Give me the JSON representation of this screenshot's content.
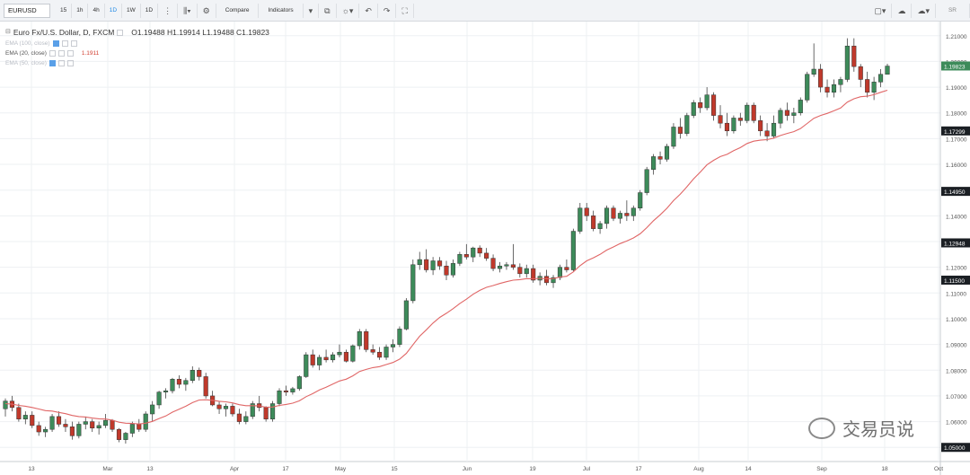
{
  "toolbar": {
    "symbol": "EURUSD",
    "intervals": [
      "15",
      "1h",
      "4h",
      "1D",
      "1W",
      "1D"
    ],
    "compare_label": "Compare",
    "indicators_label": "Indicators",
    "right_label": "SR"
  },
  "legend": {
    "title": "Euro Fx/U.S. Dollar, D, FXCM",
    "ohlc": "O1.19488  H1.19914  L1.19488  C1.19823",
    "ema_label": "EMA (20, close)",
    "ema_value": "1.1911",
    "faint_row1": "EMA (100, close)",
    "faint_row3": "EMA (50, close)"
  },
  "watermark": "交易员说",
  "colors": {
    "up": "#3d8b5a",
    "down": "#c0392b",
    "ema": "#e06666",
    "axis_text": "#555555",
    "grid": "#eef0f3"
  },
  "chart_data": {
    "type": "candlestick",
    "title": "Euro Fx/U.S. Dollar, D, FXCM",
    "ylim": [
      1.0445,
      1.2155
    ],
    "y_ticks": [
      "1.21000",
      "1.20000",
      "1.19000",
      "1.18000",
      "1.17000",
      "1.16000",
      "1.15000",
      "1.14000",
      "1.13000",
      "1.12000",
      "1.11000",
      "1.10000",
      "1.09000",
      "1.08000",
      "1.07000",
      "1.06000",
      "1.05000"
    ],
    "x_ticks": [
      "13",
      "Mar",
      "13",
      "Apr",
      "17",
      "May",
      "15",
      "Jun",
      "19",
      "Jul",
      "17",
      "Aug",
      "14",
      "Sep",
      "18",
      "Oct"
    ],
    "price_labels": [
      {
        "value": "1.19823",
        "style": "green"
      },
      {
        "value": "1.17299",
        "style": "dark"
      },
      {
        "value": "1.14950",
        "style": "dark"
      },
      {
        "value": "1.12948",
        "style": "dark"
      },
      {
        "value": "1.11500",
        "style": "dark"
      },
      {
        "value": "1.05000",
        "style": "dark"
      }
    ],
    "series": [
      {
        "name": "EURUSD",
        "kind": "candles",
        "ohlc": [
          [
            1.065,
            1.069,
            1.062,
            1.068
          ],
          [
            1.068,
            1.07,
            1.064,
            1.0655
          ],
          [
            1.0655,
            1.067,
            1.06,
            1.061
          ],
          [
            1.061,
            1.064,
            1.059,
            1.0625
          ],
          [
            1.0625,
            1.064,
            1.0575,
            1.0585
          ],
          [
            1.0585,
            1.06,
            1.0545,
            1.056
          ],
          [
            1.056,
            1.058,
            1.054,
            1.057
          ],
          [
            1.057,
            1.063,
            1.056,
            1.062
          ],
          [
            1.062,
            1.064,
            1.058,
            1.059
          ],
          [
            1.059,
            1.061,
            1.056,
            1.058
          ],
          [
            1.058,
            1.06,
            1.053,
            1.0545
          ],
          [
            1.0545,
            1.06,
            1.0535,
            1.059
          ],
          [
            1.059,
            1.062,
            1.057,
            1.06
          ],
          [
            1.06,
            1.061,
            1.056,
            1.0575
          ],
          [
            1.0575,
            1.06,
            1.055,
            1.0585
          ],
          [
            1.0585,
            1.063,
            1.0575,
            1.0605
          ],
          [
            1.0605,
            1.061,
            1.056,
            1.057
          ],
          [
            1.057,
            1.0575,
            1.052,
            1.053
          ],
          [
            1.053,
            1.056,
            1.0515,
            1.0555
          ],
          [
            1.0555,
            1.06,
            1.054,
            1.059
          ],
          [
            1.059,
            1.061,
            1.056,
            1.057
          ],
          [
            1.057,
            1.064,
            1.056,
            1.063
          ],
          [
            1.063,
            1.068,
            1.06,
            1.0665
          ],
          [
            1.0665,
            1.072,
            1.065,
            1.0715
          ],
          [
            1.0715,
            1.073,
            1.069,
            1.072
          ],
          [
            1.072,
            1.077,
            1.071,
            1.0765
          ],
          [
            1.0765,
            1.078,
            1.073,
            1.0745
          ],
          [
            1.0745,
            1.077,
            1.072,
            1.076
          ],
          [
            1.076,
            1.0815,
            1.075,
            1.08
          ],
          [
            1.08,
            1.081,
            1.076,
            1.0775
          ],
          [
            1.0775,
            1.079,
            1.069,
            1.07
          ],
          [
            1.07,
            1.072,
            1.066,
            1.0665
          ],
          [
            1.0665,
            1.068,
            1.063,
            1.065
          ],
          [
            1.065,
            1.067,
            1.062,
            1.066
          ],
          [
            1.066,
            1.067,
            1.062,
            1.063
          ],
          [
            1.063,
            1.065,
            1.059,
            1.06
          ],
          [
            1.06,
            1.064,
            1.059,
            1.062
          ],
          [
            1.062,
            1.068,
            1.061,
            1.067
          ],
          [
            1.067,
            1.07,
            1.064,
            1.0655
          ],
          [
            1.0655,
            1.066,
            1.06,
            1.061
          ],
          [
            1.061,
            1.068,
            1.06,
            1.067
          ],
          [
            1.067,
            1.073,
            1.066,
            1.072
          ],
          [
            1.072,
            1.074,
            1.07,
            1.0715
          ],
          [
            1.0715,
            1.0735,
            1.0705,
            1.0728
          ],
          [
            1.0728,
            1.078,
            1.072,
            1.0775
          ],
          [
            1.0775,
            1.087,
            1.077,
            1.086
          ],
          [
            1.086,
            1.088,
            1.081,
            1.082
          ],
          [
            1.082,
            1.086,
            1.08,
            1.085
          ],
          [
            1.085,
            1.088,
            1.083,
            1.084
          ],
          [
            1.084,
            1.087,
            1.083,
            1.086
          ],
          [
            1.086,
            1.09,
            1.085,
            1.087
          ],
          [
            1.087,
            1.088,
            1.083,
            1.0835
          ],
          [
            1.0835,
            1.09,
            1.083,
            1.0895
          ],
          [
            1.0895,
            1.096,
            1.088,
            1.095
          ],
          [
            1.095,
            1.096,
            1.087,
            1.088
          ],
          [
            1.088,
            1.09,
            1.086,
            1.087
          ],
          [
            1.087,
            1.089,
            1.084,
            1.085
          ],
          [
            1.085,
            1.09,
            1.084,
            1.089
          ],
          [
            1.089,
            1.092,
            1.087,
            1.09
          ],
          [
            1.09,
            1.097,
            1.089,
            1.096
          ],
          [
            1.096,
            1.108,
            1.0955,
            1.107
          ],
          [
            1.107,
            1.123,
            1.106,
            1.121
          ],
          [
            1.121,
            1.126,
            1.119,
            1.123
          ],
          [
            1.123,
            1.127,
            1.118,
            1.119
          ],
          [
            1.119,
            1.124,
            1.117,
            1.1225
          ],
          [
            1.1225,
            1.124,
            1.119,
            1.1205
          ],
          [
            1.1205,
            1.1225,
            1.115,
            1.117
          ],
          [
            1.117,
            1.123,
            1.116,
            1.1215
          ],
          [
            1.1215,
            1.126,
            1.1205,
            1.125
          ],
          [
            1.125,
            1.129,
            1.123,
            1.124
          ],
          [
            1.124,
            1.128,
            1.122,
            1.1275
          ],
          [
            1.1275,
            1.1285,
            1.124,
            1.1255
          ],
          [
            1.1255,
            1.1275,
            1.1225,
            1.1235
          ],
          [
            1.1235,
            1.125,
            1.1185,
            1.1195
          ],
          [
            1.1195,
            1.122,
            1.118,
            1.1205
          ],
          [
            1.1205,
            1.122,
            1.119,
            1.121
          ],
          [
            1.121,
            1.129,
            1.119,
            1.12
          ],
          [
            1.12,
            1.1215,
            1.116,
            1.1175
          ],
          [
            1.1175,
            1.121,
            1.116,
            1.1195
          ],
          [
            1.1195,
            1.121,
            1.114,
            1.115
          ],
          [
            1.115,
            1.118,
            1.113,
            1.1165
          ],
          [
            1.1165,
            1.119,
            1.113,
            1.114
          ],
          [
            1.114,
            1.117,
            1.112,
            1.116
          ],
          [
            1.116,
            1.121,
            1.115,
            1.12
          ],
          [
            1.12,
            1.123,
            1.118,
            1.119
          ],
          [
            1.119,
            1.135,
            1.1185,
            1.134
          ],
          [
            1.134,
            1.145,
            1.133,
            1.143
          ],
          [
            1.143,
            1.145,
            1.138,
            1.14
          ],
          [
            1.14,
            1.142,
            1.134,
            1.135
          ],
          [
            1.135,
            1.138,
            1.133,
            1.137
          ],
          [
            1.137,
            1.144,
            1.135,
            1.143
          ],
          [
            1.143,
            1.144,
            1.138,
            1.139
          ],
          [
            1.139,
            1.142,
            1.137,
            1.141
          ],
          [
            1.141,
            1.146,
            1.138,
            1.14
          ],
          [
            1.14,
            1.144,
            1.138,
            1.143
          ],
          [
            1.143,
            1.15,
            1.142,
            1.149
          ],
          [
            1.149,
            1.159,
            1.148,
            1.158
          ],
          [
            1.158,
            1.164,
            1.156,
            1.163
          ],
          [
            1.163,
            1.165,
            1.16,
            1.162
          ],
          [
            1.162,
            1.168,
            1.161,
            1.167
          ],
          [
            1.167,
            1.176,
            1.166,
            1.1745
          ],
          [
            1.1745,
            1.178,
            1.17,
            1.172
          ],
          [
            1.172,
            1.18,
            1.171,
            1.179
          ],
          [
            1.179,
            1.185,
            1.178,
            1.184
          ],
          [
            1.184,
            1.186,
            1.18,
            1.182
          ],
          [
            1.182,
            1.19,
            1.181,
            1.187
          ],
          [
            1.187,
            1.188,
            1.177,
            1.179
          ],
          [
            1.179,
            1.183,
            1.174,
            1.176
          ],
          [
            1.176,
            1.18,
            1.171,
            1.173
          ],
          [
            1.173,
            1.179,
            1.172,
            1.178
          ],
          [
            1.178,
            1.18,
            1.175,
            1.177
          ],
          [
            1.177,
            1.184,
            1.176,
            1.183
          ],
          [
            1.183,
            1.184,
            1.176,
            1.177
          ],
          [
            1.177,
            1.179,
            1.171,
            1.173
          ],
          [
            1.173,
            1.176,
            1.169,
            1.171
          ],
          [
            1.171,
            1.179,
            1.17,
            1.176
          ],
          [
            1.176,
            1.182,
            1.174,
            1.181
          ],
          [
            1.181,
            1.184,
            1.177,
            1.179
          ],
          [
            1.179,
            1.182,
            1.176,
            1.18
          ],
          [
            1.18,
            1.186,
            1.179,
            1.185
          ],
          [
            1.185,
            1.196,
            1.184,
            1.195
          ],
          [
            1.195,
            1.207,
            1.194,
            1.197
          ],
          [
            1.197,
            1.199,
            1.188,
            1.19
          ],
          [
            1.19,
            1.193,
            1.186,
            1.188
          ],
          [
            1.188,
            1.193,
            1.186,
            1.191
          ],
          [
            1.191,
            1.194,
            1.188,
            1.193
          ],
          [
            1.193,
            1.209,
            1.192,
            1.206
          ],
          [
            1.206,
            1.209,
            1.196,
            1.198
          ],
          [
            1.198,
            1.199,
            1.19,
            1.193
          ],
          [
            1.193,
            1.196,
            1.186,
            1.188
          ],
          [
            1.188,
            1.194,
            1.185,
            1.192
          ],
          [
            1.192,
            1.197,
            1.19,
            1.195
          ],
          [
            1.195,
            1.1991,
            1.1949,
            1.1982
          ]
        ]
      },
      {
        "name": "EMA (20, close)",
        "kind": "line",
        "values": [
          1.067,
          1.0668,
          1.0663,
          1.066,
          1.0655,
          1.0649,
          1.0643,
          1.0641,
          1.0636,
          1.0631,
          1.0624,
          1.062,
          1.0618,
          1.0614,
          1.0611,
          1.061,
          1.0606,
          1.0598,
          1.0594,
          1.0593,
          1.0591,
          1.0594,
          1.0601,
          1.0612,
          1.0622,
          1.0637,
          1.0648,
          1.066,
          1.0674,
          1.0684,
          1.0685,
          1.0683,
          1.0679,
          1.0677,
          1.0673,
          1.0666,
          1.0662,
          1.0662,
          1.0661,
          1.0656,
          1.0657,
          1.0663,
          1.0667,
          1.0672,
          1.0681,
          1.0697,
          1.0709,
          1.0723,
          1.0734,
          1.0746,
          1.0758,
          1.0765,
          1.0778,
          1.0795,
          1.0803,
          1.081,
          1.0814,
          1.0822,
          1.083,
          1.0843,
          1.0865,
          1.0899,
          1.0932,
          1.0957,
          1.0983,
          1.1005,
          1.1021,
          1.1039,
          1.1059,
          1.1076,
          1.1095,
          1.111,
          1.1122,
          1.1129,
          1.1137,
          1.1144,
          1.115,
          1.1152,
          1.1156,
          1.1155,
          1.1157,
          1.1155,
          1.1156,
          1.1162,
          1.1165,
          1.1182,
          1.1206,
          1.1225,
          1.1237,
          1.125,
          1.1267,
          1.1279,
          1.1292,
          1.1302,
          1.1314,
          1.133,
          1.1354,
          1.1381,
          1.1404,
          1.1429,
          1.1459,
          1.1484,
          1.1513,
          1.1544,
          1.157,
          1.1598,
          1.1616,
          1.163,
          1.1639,
          1.1653,
          1.1665,
          1.1681,
          1.169,
          1.1694,
          1.1696,
          1.1702,
          1.1712,
          1.172,
          1.1727,
          1.1739,
          1.1759,
          1.1779,
          1.179,
          1.1798,
          1.1808,
          1.1819,
          1.1842,
          1.1855,
          1.1863,
          1.1865,
          1.1871,
          1.188,
          1.1888
        ]
      }
    ]
  }
}
